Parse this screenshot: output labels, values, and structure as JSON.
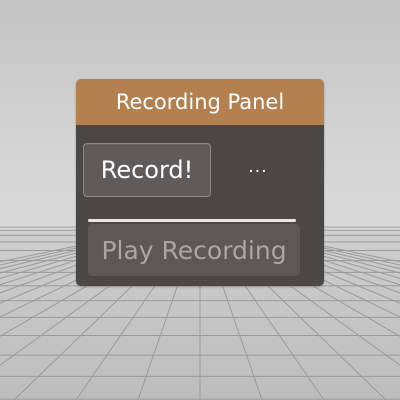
{
  "panel": {
    "title": "Recording Panel",
    "record_label": "Record!",
    "status_text": "...",
    "play_label": "Play Recording"
  },
  "colors": {
    "header_bg": "#b5804f",
    "body_bg": "#4b4744",
    "record_bg": "#5f5b59",
    "play_bg": "#5c5856",
    "play_text": "#a9a6a3",
    "separator": "#e6e6e6",
    "floor_line": "#9a9a9a"
  }
}
